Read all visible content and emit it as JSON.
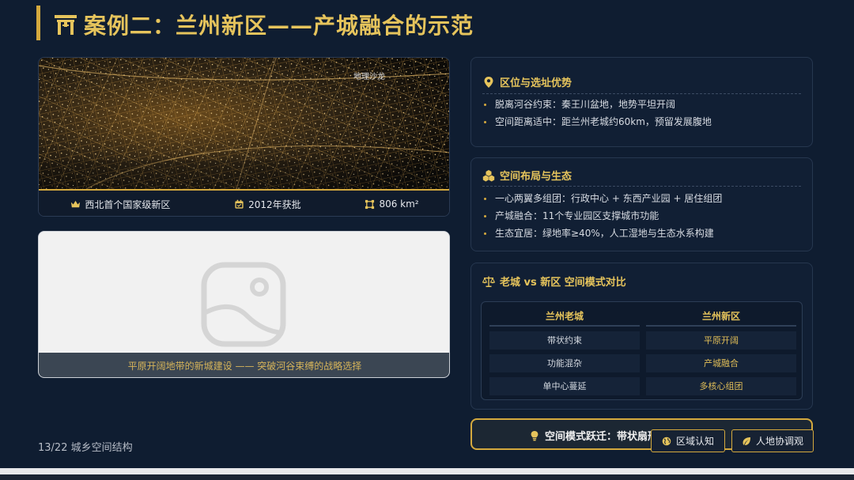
{
  "title": "案例二：兰州新区——产城融合的示范",
  "photo": {
    "watermark": "地理沙龙",
    "stats": [
      {
        "icon": "crown-icon",
        "label": "西北首个国家级新区"
      },
      {
        "icon": "calendar-icon",
        "label": "2012年获批"
      },
      {
        "icon": "area-icon",
        "label": "806 km²"
      }
    ]
  },
  "placeholder": {
    "caption": "平原开阔地带的新城建设 —— 突破河谷束缚的战略选择"
  },
  "page_number": "13/22 城乡空间结构",
  "panels": {
    "location": {
      "icon": "map-pin-icon",
      "heading": "区位与选址优势",
      "items": [
        "脱离河谷约束：秦王川盆地，地势平坦开阔",
        "空间距离适中：距兰州老城约60km，预留发展腹地"
      ]
    },
    "layout": {
      "icon": "cubes-icon",
      "heading": "空间布局与生态",
      "items": [
        "一心两翼多组团：行政中心 + 东西产业园 + 居住组团",
        "产城融合：11个专业园区支撑城市功能",
        "生态宜居：绿地率≥40%，人工湿地与生态水系构建"
      ]
    },
    "compare": {
      "icon": "scale-icon",
      "heading": "老城 vs 新区 空间模式对比",
      "left_header": "兰州老城",
      "right_header": "兰州新区",
      "left_cells": [
        "带状约束",
        "功能混杂",
        "单中心蔓延"
      ],
      "right_cells": [
        "平原开阔",
        "产城融合",
        "多核心组团"
      ]
    }
  },
  "summary": {
    "icon": "lightbulb-icon",
    "text": "空间模式跃迁：带状扇形"
  },
  "tags": [
    {
      "icon": "globe-icon",
      "label": "区域认知"
    },
    {
      "icon": "leaf-icon",
      "label": "人地协调观"
    }
  ],
  "colors": {
    "background": "#0f1d31",
    "accent_gold": "#e6c45c",
    "panel": "#111f34"
  }
}
